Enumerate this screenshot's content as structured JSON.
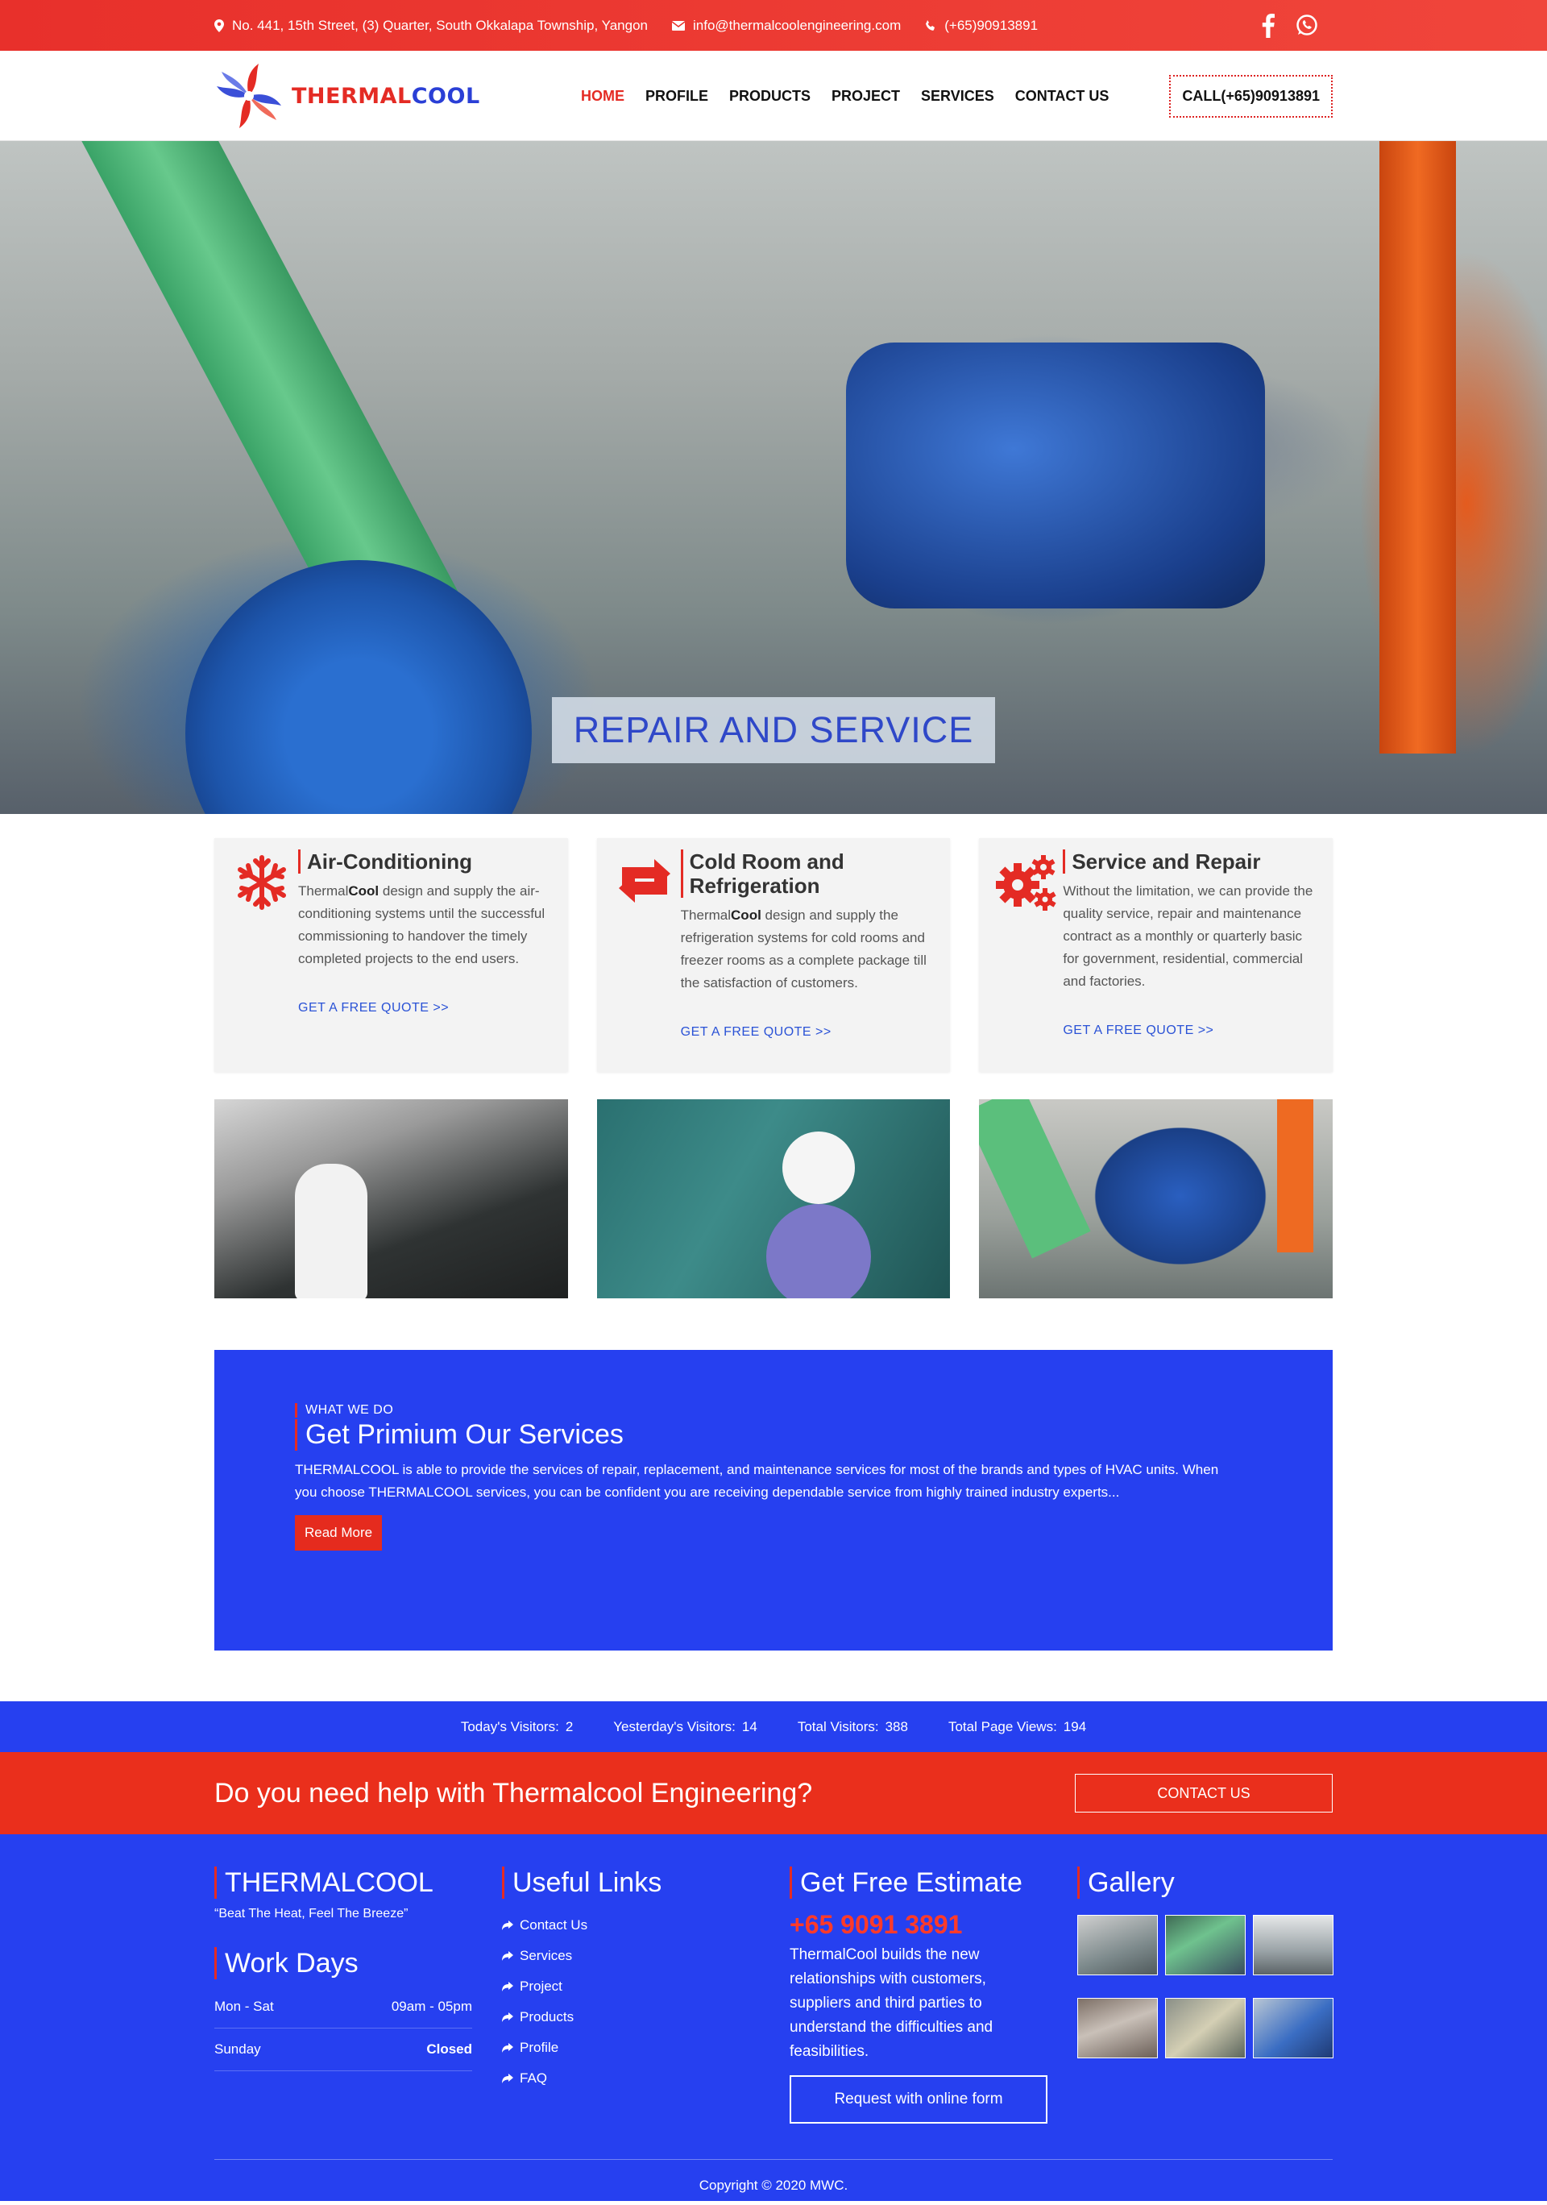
{
  "topbar": {
    "address": "No. 441, 15th Street, (3) Quarter, South Okkalapa Township, Yangon",
    "email": "info@thermalcoolengineering.com",
    "phone": "(+65)90913891"
  },
  "header": {
    "logo_part1": "THERMAL",
    "logo_part2": "COOL",
    "nav": [
      "HOME",
      "PROFILE",
      "PRODUCTS",
      "PROJECT",
      "SERVICES",
      "CONTACT US"
    ],
    "call_button": "CALL(+65)90913891"
  },
  "hero": {
    "title": "REPAIR AND SERVICE"
  },
  "features": [
    {
      "title": "Air-Conditioning",
      "text_prefix": "Thermal",
      "text_bold": "Cool",
      "text": " design and supply the air-conditioning systems until the successful commissioning to handover the timely completed projects to the end users.",
      "link": "GET A FREE QUOTE >>"
    },
    {
      "title": "Cold Room and Refrigeration",
      "text_prefix": "Thermal",
      "text_bold": "Cool",
      "text": " design and supply the refrigeration systems for cold rooms and freezer rooms as a complete package till the satisfaction of customers.",
      "link": "GET A FREE QUOTE >>"
    },
    {
      "title": "Service and Repair",
      "text_prefix": "",
      "text_bold": "",
      "text": "Without the limitation, we can provide the quality service, repair and maintenance contract as a monthly or quarterly basic for government, residential, commercial and factories.",
      "link": "GET A FREE QUOTE >>"
    }
  ],
  "services": {
    "eyebrow": "WHAT WE DO",
    "title": "Get Primium Our Services",
    "text": "THERMALCOOL is able to provide the services of repair, replacement, and maintenance services for most of the brands and types of HVAC units. When you choose THERMALCOOL services, you can be confident you are receiving dependable service from highly trained industry experts...",
    "button": "Read More"
  },
  "visitors": [
    {
      "label": "Today's Visitors:",
      "value": "2"
    },
    {
      "label": "Yesterday's Visitors:",
      "value": "14"
    },
    {
      "label": "Total Visitors:",
      "value": "388"
    },
    {
      "label": "Total Page Views:",
      "value": "194"
    }
  ],
  "help": {
    "text": "Do you need help with Thermalcool Engineering?",
    "button": "CONTACT US"
  },
  "footer": {
    "brand": "THERMALCOOL",
    "tagline": "“Beat The Heat, Feel The Breeze”",
    "workdays_title": "Work Days",
    "workdays": [
      {
        "day": "Mon - Sat",
        "hours": "09am - 05pm"
      },
      {
        "day": "Sunday",
        "hours": "Closed"
      }
    ],
    "links_title": "Useful Links",
    "links": [
      "Contact Us",
      "Services",
      "Project",
      "Products",
      "Profile",
      "FAQ"
    ],
    "estimate_title": "Get Free Estimate",
    "estimate_phone": "+65 9091 3891",
    "estimate_text": "ThermalCool builds the new relationships with customers, suppliers and third parties to understand the difficulties and feasibilities.",
    "estimate_button": "Request with online form",
    "gallery_title": "Gallery",
    "copyright": "Copyright © 2020 MWC."
  },
  "colors": {
    "brand_red": "#e42b24",
    "brand_blue": "#2640f0"
  }
}
